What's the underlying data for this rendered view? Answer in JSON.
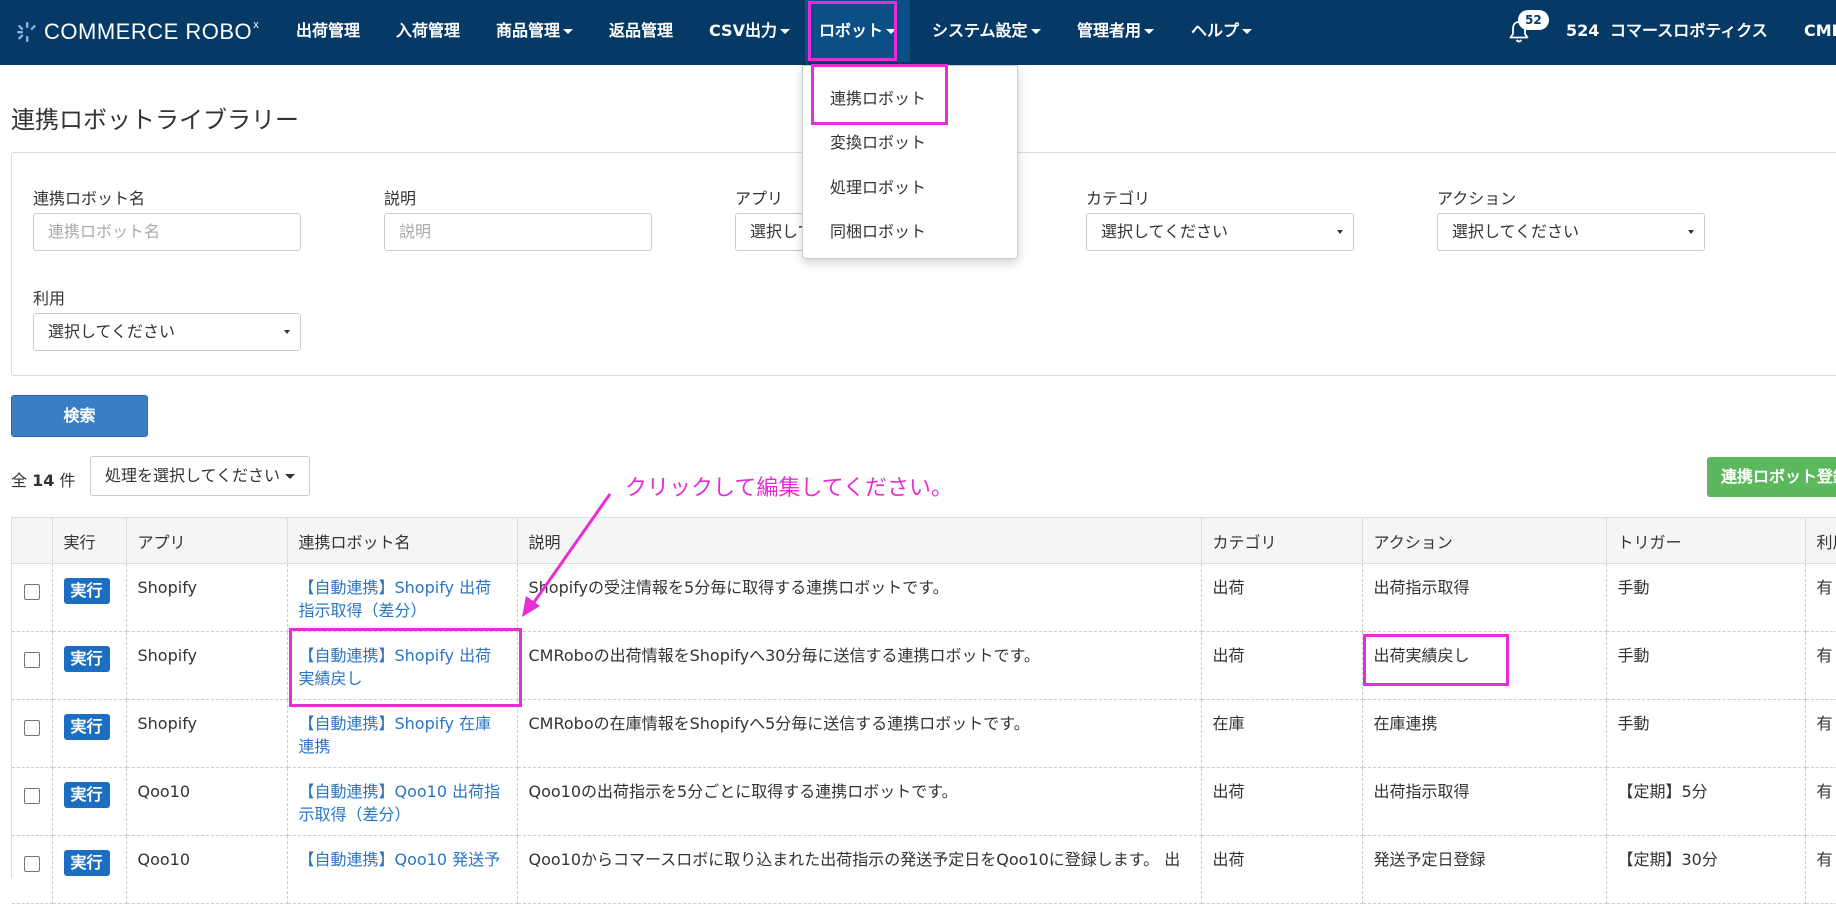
{
  "nav": {
    "brand": "COMMERCE ROBO",
    "brand_mark": "x",
    "items": [
      {
        "label": "出荷管理",
        "caret": false
      },
      {
        "label": "入荷管理",
        "caret": false
      },
      {
        "label": "商品管理",
        "caret": true
      },
      {
        "label": "返品管理",
        "caret": false
      },
      {
        "label": "CSV出力",
        "caret": true
      },
      {
        "label": "ロボット",
        "caret": true,
        "active": true
      },
      {
        "label": "システム設定",
        "caret": true
      },
      {
        "label": "管理者用",
        "caret": true
      },
      {
        "label": "ヘルプ",
        "caret": true
      }
    ],
    "notification_count": "52",
    "account_id": "524",
    "company_name": "コマースロボティクス",
    "user_name_partial": "CMR"
  },
  "dropdown": {
    "items": [
      "連携ロボット",
      "変換ロボット",
      "処理ロボット",
      "同梱ロボット"
    ]
  },
  "page": {
    "title": "連携ロボットライブラリー"
  },
  "filters": {
    "robot_name_label": "連携ロボット名",
    "robot_name_placeholder": "連携ロボット名",
    "description_label": "説明",
    "description_placeholder": "説明",
    "app_label": "アプリ",
    "app_value": "選択してください",
    "category_label": "カテゴリ",
    "category_value": "選択してください",
    "action_label": "アクション",
    "action_value": "選択してください",
    "usage_label": "利用",
    "usage_value": "選択してください"
  },
  "search_button": "検索",
  "results": {
    "count_prefix": "全",
    "count": "14",
    "count_suffix": "件",
    "action_select": "処理を選択してください",
    "register_button": "連携ロボット登録"
  },
  "annotation": "クリックして編集してください。",
  "table": {
    "headers": [
      "",
      "実行",
      "アプリ",
      "連携ロボット名",
      "説明",
      "カテゴリ",
      "アクション",
      "トリガー",
      "利用"
    ],
    "run_label": "実行",
    "rows": [
      {
        "app": "Shopify",
        "name": "【自動連携】Shopify 出荷指示取得（差分）",
        "description": "Shopifyの受注情報を5分毎に取得する連携ロボットです。",
        "category": "出荷",
        "action": "出荷指示取得",
        "trigger": "手動",
        "usage": "有"
      },
      {
        "app": "Shopify",
        "name": "【自動連携】Shopify 出荷実績戻し",
        "description": "CMRoboの出荷情報をShopifyへ30分毎に送信する連携ロボットです。",
        "category": "出荷",
        "action": "出荷実績戻し",
        "trigger": "手動",
        "usage": "有"
      },
      {
        "app": "Shopify",
        "name": "【自動連携】Shopify 在庫連携",
        "description": "CMRoboの在庫情報をShopifyへ5分毎に送信する連携ロボットです。",
        "category": "在庫",
        "action": "在庫連携",
        "trigger": "手動",
        "usage": "有"
      },
      {
        "app": "Qoo10",
        "name": "【自動連携】Qoo10 出荷指示取得（差分）",
        "description": "Qoo10の出荷指示を5分ごとに取得する連携ロボットです。",
        "category": "出荷",
        "action": "出荷指示取得",
        "trigger": "【定期】5分",
        "usage": "有"
      },
      {
        "app": "Qoo10",
        "name": "【自動連携】Qoo10 発送予",
        "description": "Qoo10からコマースロボに取り込まれた出荷指示の発送予定日をQoo10に登録します。 出",
        "category": "出荷",
        "action": "発送予定日登録",
        "trigger": "【定期】30分",
        "usage": "有"
      }
    ]
  },
  "colors": {
    "navbar": "#063a66",
    "highlight": "#e82dd6",
    "link": "#2a75c5",
    "run_button": "#1b6ec2",
    "search_button": "#3a7fc6",
    "register_button": "#5cb85c"
  }
}
